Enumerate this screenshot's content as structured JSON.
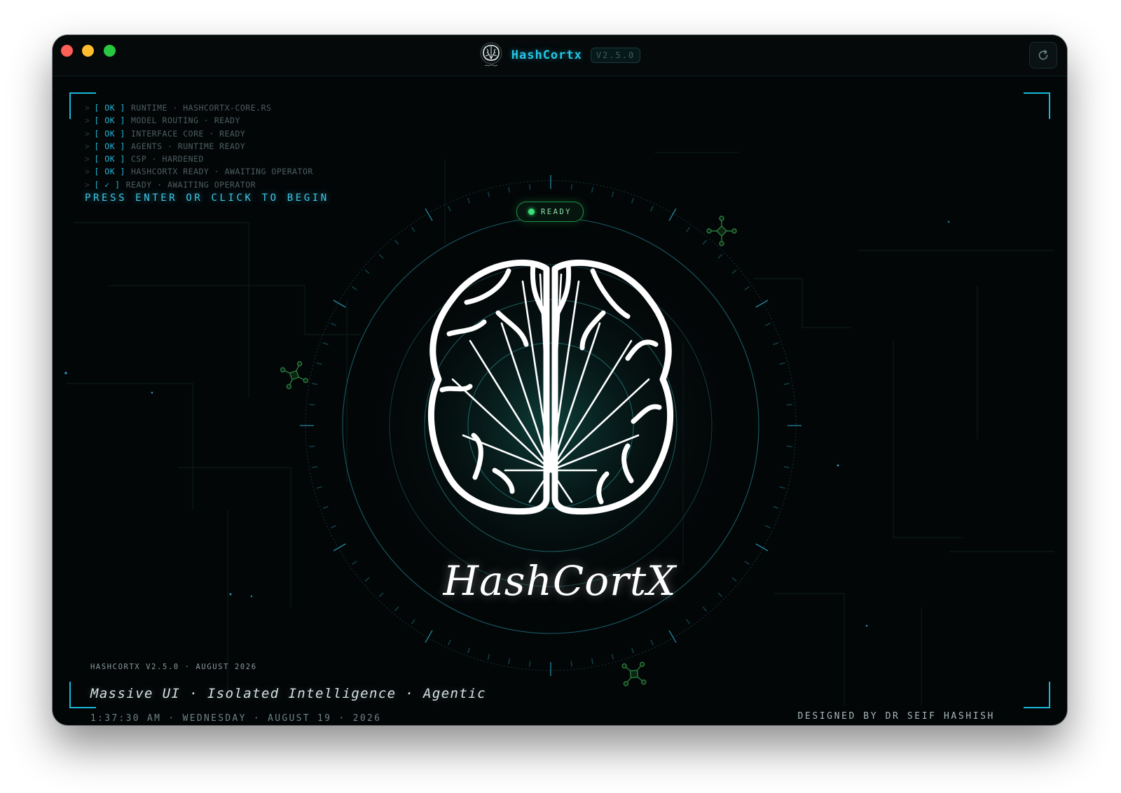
{
  "window": {
    "app_name": "HashCortx",
    "version": "V2.5.0"
  },
  "icons": {
    "app": "brain-icon",
    "refresh": "refresh-icon",
    "node": "network-node-icon"
  },
  "boot_log": [
    {
      "status": "[ OK ]",
      "text": "RUNTIME · HASHCORTX-CORE.RS"
    },
    {
      "status": "[ OK ]",
      "text": "MODEL ROUTING · READY"
    },
    {
      "status": "[ OK ]",
      "text": "INTERFACE CORE · READY"
    },
    {
      "status": "[ OK ]",
      "text": "AGENTS · RUNTIME READY"
    },
    {
      "status": "[ OK ]",
      "text": "CSP · HARDENED"
    },
    {
      "status": "[ OK ]",
      "text": "HASHCORTX READY · AWAITING OPERATOR"
    },
    {
      "status": "[ ✓ ]",
      "text": "READY · AWAITING OPERATOR"
    }
  ],
  "prompt": "PRESS ENTER OR CLICK TO BEGIN",
  "status_pill": "READY",
  "logo_wordmark": "HashCortX",
  "footer": {
    "meta": "HASHCORTX V2.5.0 · AUGUST 2026",
    "tagline": "Massive UI · Isolated Intelligence · Agentic",
    "clock": "1:37:30 AM · WEDNESDAY · AUGUST 19 · 2026",
    "designer": "DESIGNED BY DR SEIF HASHISH"
  },
  "colors": {
    "accent": "#22b8d8",
    "ready": "#39e07a",
    "background": "#030607"
  }
}
